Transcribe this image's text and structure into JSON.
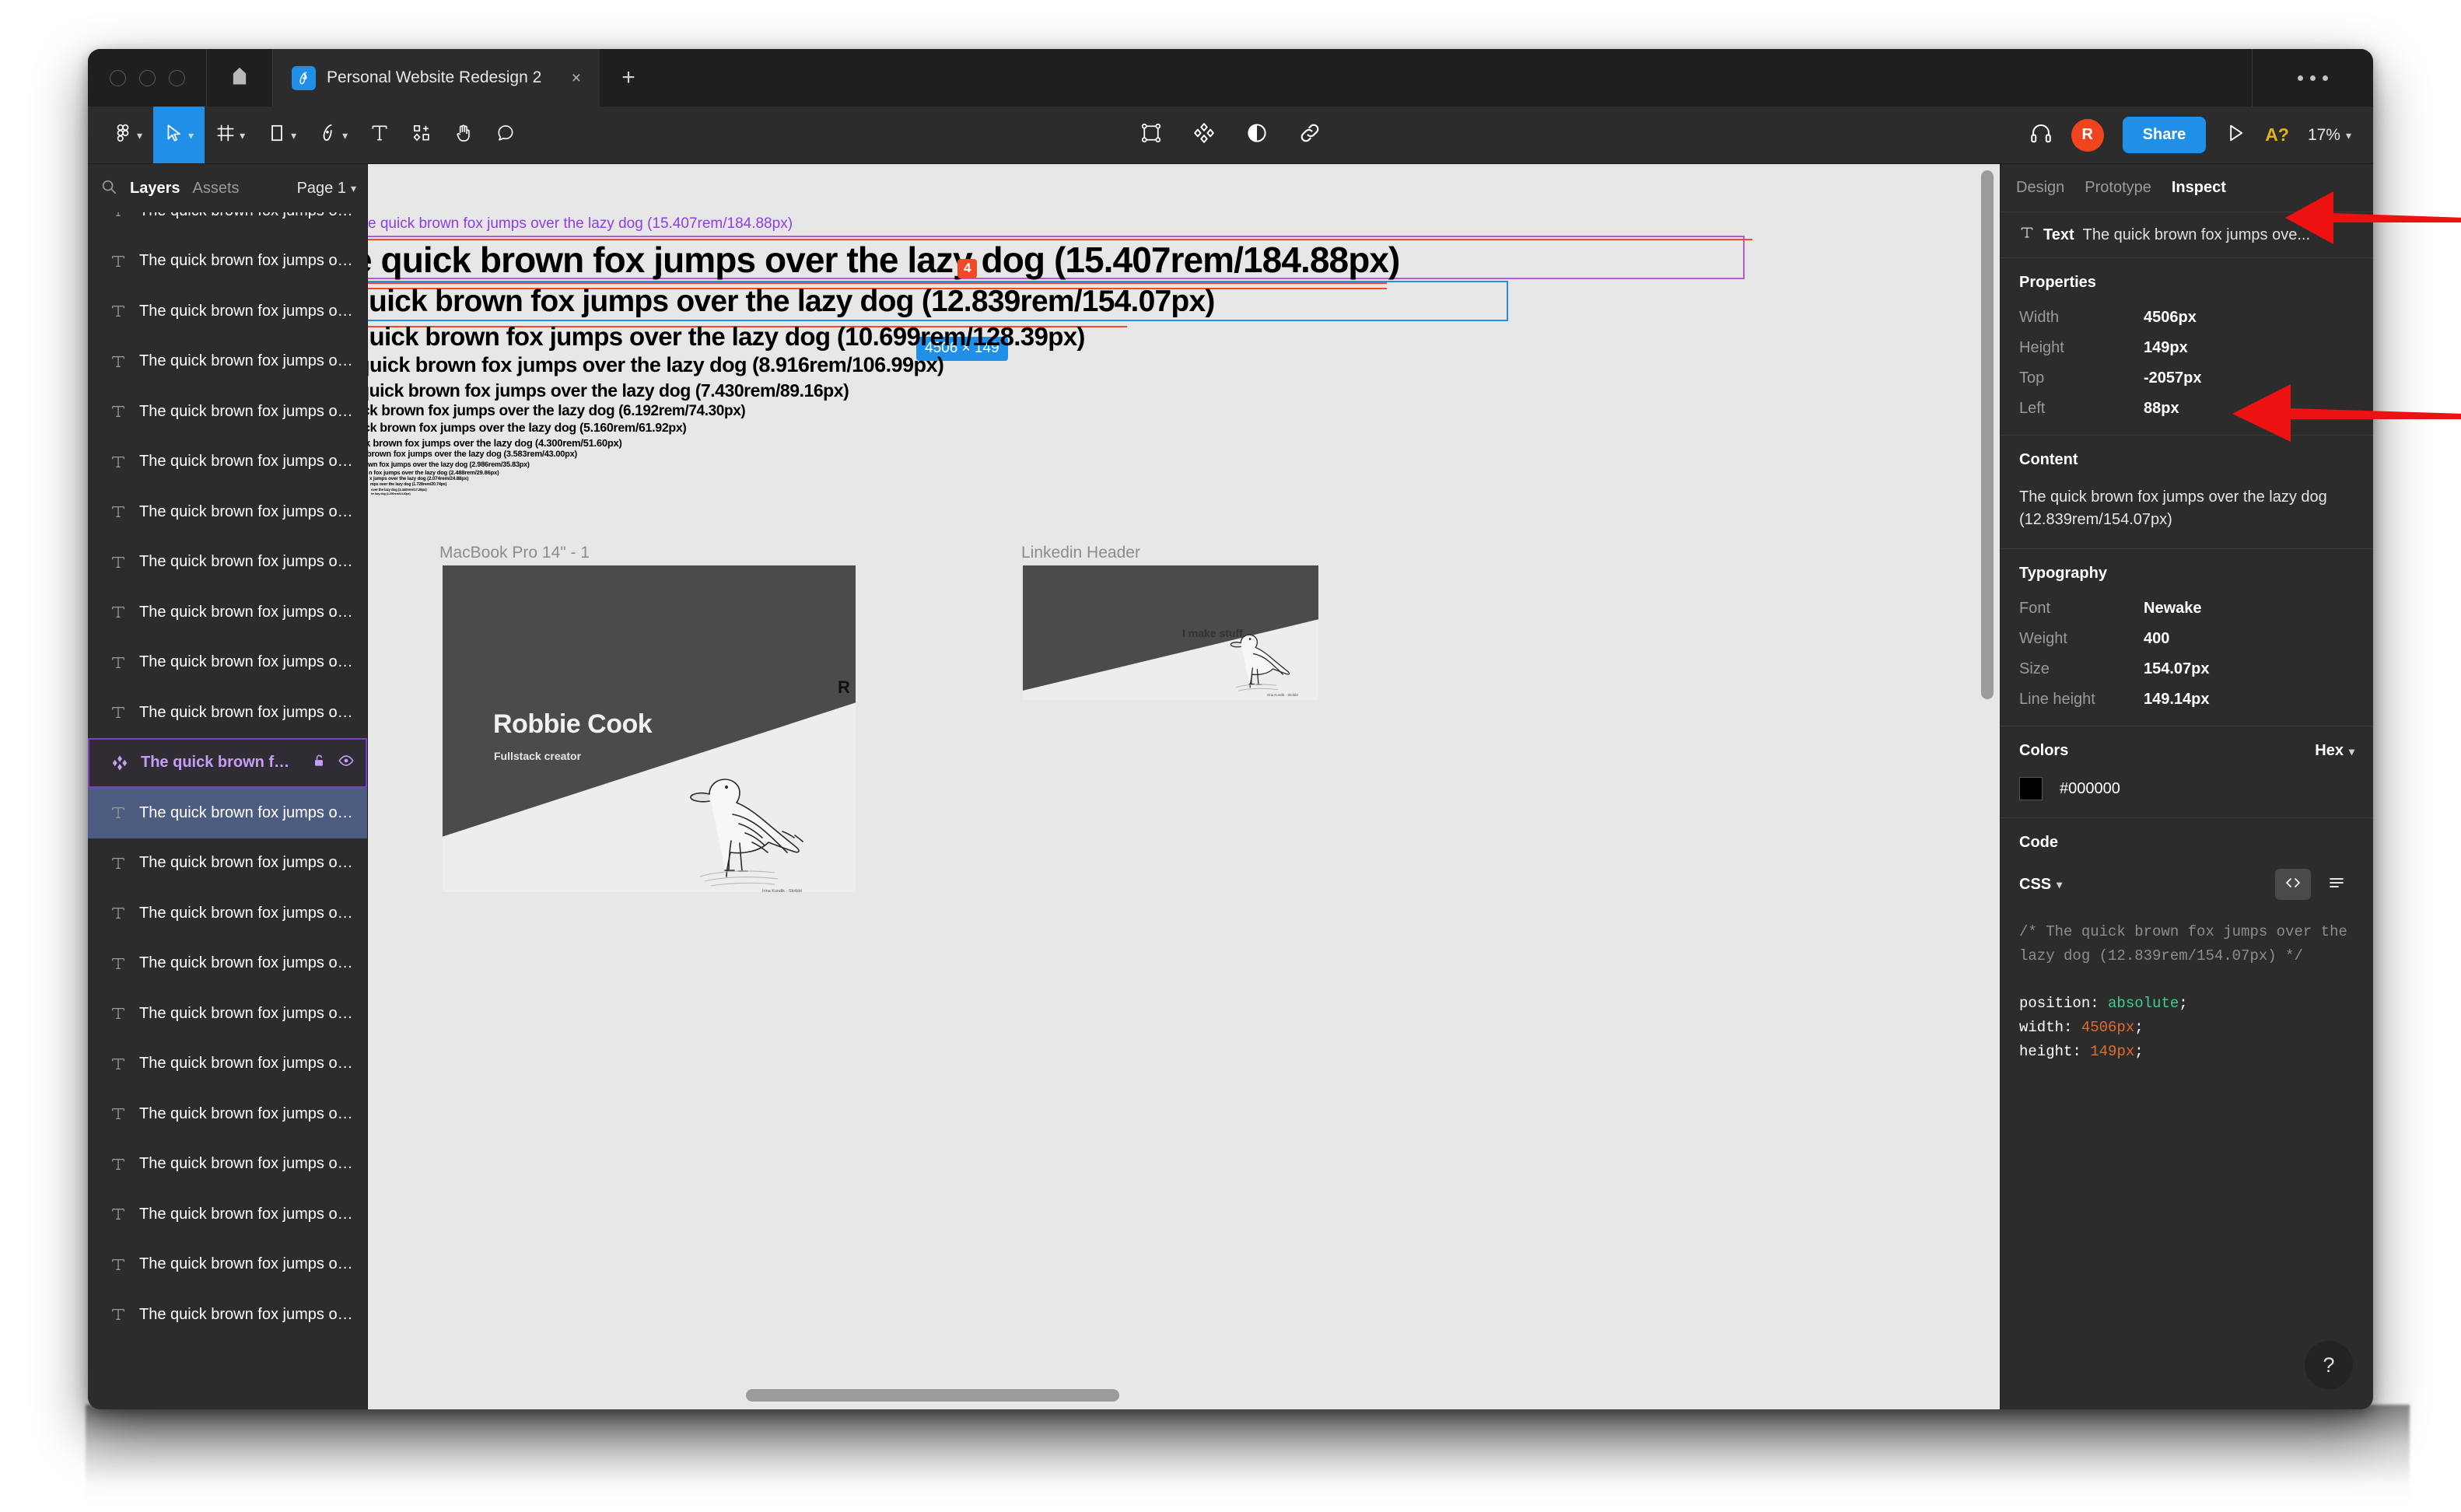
{
  "window": {
    "titlebar": {
      "traffic_lights": [
        "close",
        "minimize",
        "maximize"
      ],
      "home_icon": "home-icon",
      "tab": {
        "app_icon": "figma-logo-icon",
        "title": "Personal Website Redesign 2",
        "close_label": "×"
      },
      "new_tab_label": "+",
      "overflow_label": "•••"
    },
    "toolbar": {
      "left_tools": [
        {
          "name": "figma-menu-icon",
          "caret": true,
          "active": false
        },
        {
          "name": "move-cursor-icon",
          "caret": true,
          "active": true
        },
        {
          "name": "frame-icon",
          "caret": true,
          "active": false
        },
        {
          "name": "shape-rectangle-icon",
          "caret": true,
          "active": false
        },
        {
          "name": "pen-icon",
          "caret": true,
          "active": false
        },
        {
          "name": "text-icon",
          "caret": false,
          "active": false
        },
        {
          "name": "components-icon",
          "caret": false,
          "active": false
        },
        {
          "name": "hand-icon",
          "caret": false,
          "active": false
        },
        {
          "name": "comment-icon",
          "caret": false,
          "active": false
        }
      ],
      "center_tools": [
        {
          "name": "selection-bounds-icon"
        },
        {
          "name": "plugins-diamond-icon"
        },
        {
          "name": "contrast-icon"
        },
        {
          "name": "link-icon"
        }
      ],
      "right": {
        "headphones_icon": "headphones-icon",
        "avatar_initial": "R",
        "avatar_color": "#f0441f",
        "share_label": "Share",
        "share_color": "#1f8fe8",
        "present_icon": "play-present-icon",
        "accessibility_label": "A?",
        "accessibility_color": "#e3b315",
        "zoom_level": "17%"
      }
    }
  },
  "left_panel": {
    "search_icon": "search-icon",
    "tabs": [
      {
        "label": "Layers",
        "selected": true
      },
      {
        "label": "Assets",
        "selected": false
      }
    ],
    "page_selector": "Page 1",
    "layers": [
      {
        "icon": "text-layer-icon",
        "label": "The quick brown fox jumps over th...",
        "state": "normal",
        "partial": true
      },
      {
        "icon": "text-layer-icon",
        "label": "The quick brown fox jumps over th...",
        "state": "normal"
      },
      {
        "icon": "text-layer-icon",
        "label": "The quick brown fox jumps over th...",
        "state": "normal"
      },
      {
        "icon": "text-layer-icon",
        "label": "The quick brown fox jumps over th...",
        "state": "normal"
      },
      {
        "icon": "text-layer-icon",
        "label": "The quick brown fox jumps over th...",
        "state": "normal"
      },
      {
        "icon": "text-layer-icon",
        "label": "The quick brown fox jumps over th...",
        "state": "normal"
      },
      {
        "icon": "text-layer-icon",
        "label": "The quick brown fox jumps over th...",
        "state": "normal"
      },
      {
        "icon": "text-layer-icon",
        "label": "The quick brown fox jumps over th...",
        "state": "normal"
      },
      {
        "icon": "text-layer-icon",
        "label": "The quick brown fox jumps over th...",
        "state": "normal"
      },
      {
        "icon": "text-layer-icon",
        "label": "The quick brown fox jumps over th...",
        "state": "normal"
      },
      {
        "icon": "text-layer-icon",
        "label": "The quick brown fox jumps over th...",
        "state": "normal"
      },
      {
        "icon": "component-icon",
        "label": "The quick brown fox jum...",
        "state": "selected-purple",
        "lock_icon": "unlock-icon",
        "visible_icon": "eye-icon"
      },
      {
        "icon": "text-layer-icon",
        "label": "The quick brown fox jumps over th...",
        "state": "selected-blue"
      },
      {
        "icon": "text-layer-icon",
        "label": "The quick brown fox jumps over th...",
        "state": "normal"
      },
      {
        "icon": "text-layer-icon",
        "label": "The quick brown fox jumps over th...",
        "state": "normal"
      },
      {
        "icon": "text-layer-icon",
        "label": "The quick brown fox jumps over th...",
        "state": "normal"
      },
      {
        "icon": "text-layer-icon",
        "label": "The quick brown fox jumps over th...",
        "state": "normal"
      },
      {
        "icon": "text-layer-icon",
        "label": "The quick brown fox jumps over th...",
        "state": "normal"
      },
      {
        "icon": "text-layer-icon",
        "label": "The quick brown fox jumps over th...",
        "state": "normal"
      },
      {
        "icon": "text-layer-icon",
        "label": "The quick brown fox jumps over th...",
        "state": "normal"
      },
      {
        "icon": "text-layer-icon",
        "label": "The quick brown fox jumps over th...",
        "state": "normal"
      },
      {
        "icon": "text-layer-icon",
        "label": "The quick brown fox jumps over th...",
        "state": "normal"
      },
      {
        "icon": "text-layer-icon",
        "label": "The quick brown fox jumps over th...",
        "state": "normal"
      }
    ]
  },
  "canvas": {
    "selection_tooltip_label": "4",
    "selection_dimension_label": "4506 × 149",
    "purple_outline_label": "e quick brown fox jumps over the lazy dog (15.407rem/184.88px)",
    "type_specimens": [
      "e quick brown fox jumps over the lazy dog (15.407rem/184.88px)",
      "quick brown fox jumps over the lazy dog (12.839rem/154.07px)",
      "quick brown fox jumps over the lazy dog (10.699rem/128.39px)",
      "quick brown fox jumps over the lazy dog (8.916rem/106.99px)",
      "quick brown fox jumps over the lazy dog (7.430rem/89.16px)",
      "ck brown fox jumps over the lazy dog (6.192rem/74.30px)",
      "ck brown fox jumps over the lazy dog (5.160rem/61.92px)",
      "k brown fox jumps over the lazy dog (4.300rem/51.60px)",
      "brown fox jumps over the lazy dog (3.583rem/43.00px)",
      "wn fox jumps over the lazy dog (2.986rem/35.83px)",
      "n fox jumps over the lazy dog (2.488rem/29.86px)",
      "x jumps over the lazy dog (2.074rem/24.88px)",
      "mps over the lazy dog (1.728rem/20.74px)",
      "over the lazy dog (1.440rem/17.28px)",
      "he lazy dog (1.200rem/14.40px)"
    ],
    "frames": [
      {
        "label": "MacBook Pro 14\" - 1",
        "name": "Robbie Cook",
        "role": "Fullstack creator",
        "illustration": "seagull-illustration",
        "credit": "Irina Kundik - Skribbl"
      },
      {
        "label": "Linkedin Header",
        "illustration": "seagull-illustration",
        "credit": "Irina Kundik - Skribbl"
      }
    ],
    "standalone_text": "R",
    "tagline": "I make stuff."
  },
  "right_panel": {
    "tabs": [
      {
        "label": "Design",
        "selected": false
      },
      {
        "label": "Prototype",
        "selected": false
      },
      {
        "label": "Inspect",
        "selected": true
      }
    ],
    "selection": {
      "icon": "text-layer-icon",
      "type": "Text",
      "name": "The quick brown fox jumps ove..."
    },
    "properties": {
      "title": "Properties",
      "rows": [
        {
          "key": "Width",
          "value": "4506px"
        },
        {
          "key": "Height",
          "value": "149px"
        },
        {
          "key": "Top",
          "value": "-2057px"
        },
        {
          "key": "Left",
          "value": "88px"
        }
      ]
    },
    "content": {
      "title": "Content",
      "text": "The quick brown fox jumps over the lazy dog (12.839rem/154.07px)"
    },
    "typography": {
      "title": "Typography",
      "rows": [
        {
          "key": "Font",
          "value": "Newake"
        },
        {
          "key": "Weight",
          "value": "400"
        },
        {
          "key": "Size",
          "value": "154.07px"
        },
        {
          "key": "Line height",
          "value": "149.14px"
        }
      ]
    },
    "colors": {
      "title": "Colors",
      "format": "Hex",
      "items": [
        {
          "swatch": "#000000",
          "label": "#000000"
        }
      ]
    },
    "code": {
      "title": "Code",
      "language": "CSS",
      "copy_icon": "code-brackets-icon",
      "list_icon": "list-lines-icon",
      "comment": "/* The quick brown fox jumps over the lazy dog (12.839rem/154.07px) */",
      "lines": [
        {
          "prop": "position",
          "value": "absolute",
          "value_type": "kw"
        },
        {
          "prop": "width",
          "value": "4506px",
          "value_type": "num"
        },
        {
          "prop": "height",
          "value": "149px",
          "value_type": "num"
        }
      ]
    },
    "help_label": "?"
  },
  "annotations": [
    {
      "name": "arrow-pointing-to-inspect-tab",
      "color": "#ee1111"
    },
    {
      "name": "arrow-pointing-to-width-value",
      "color": "#ee1111"
    }
  ]
}
